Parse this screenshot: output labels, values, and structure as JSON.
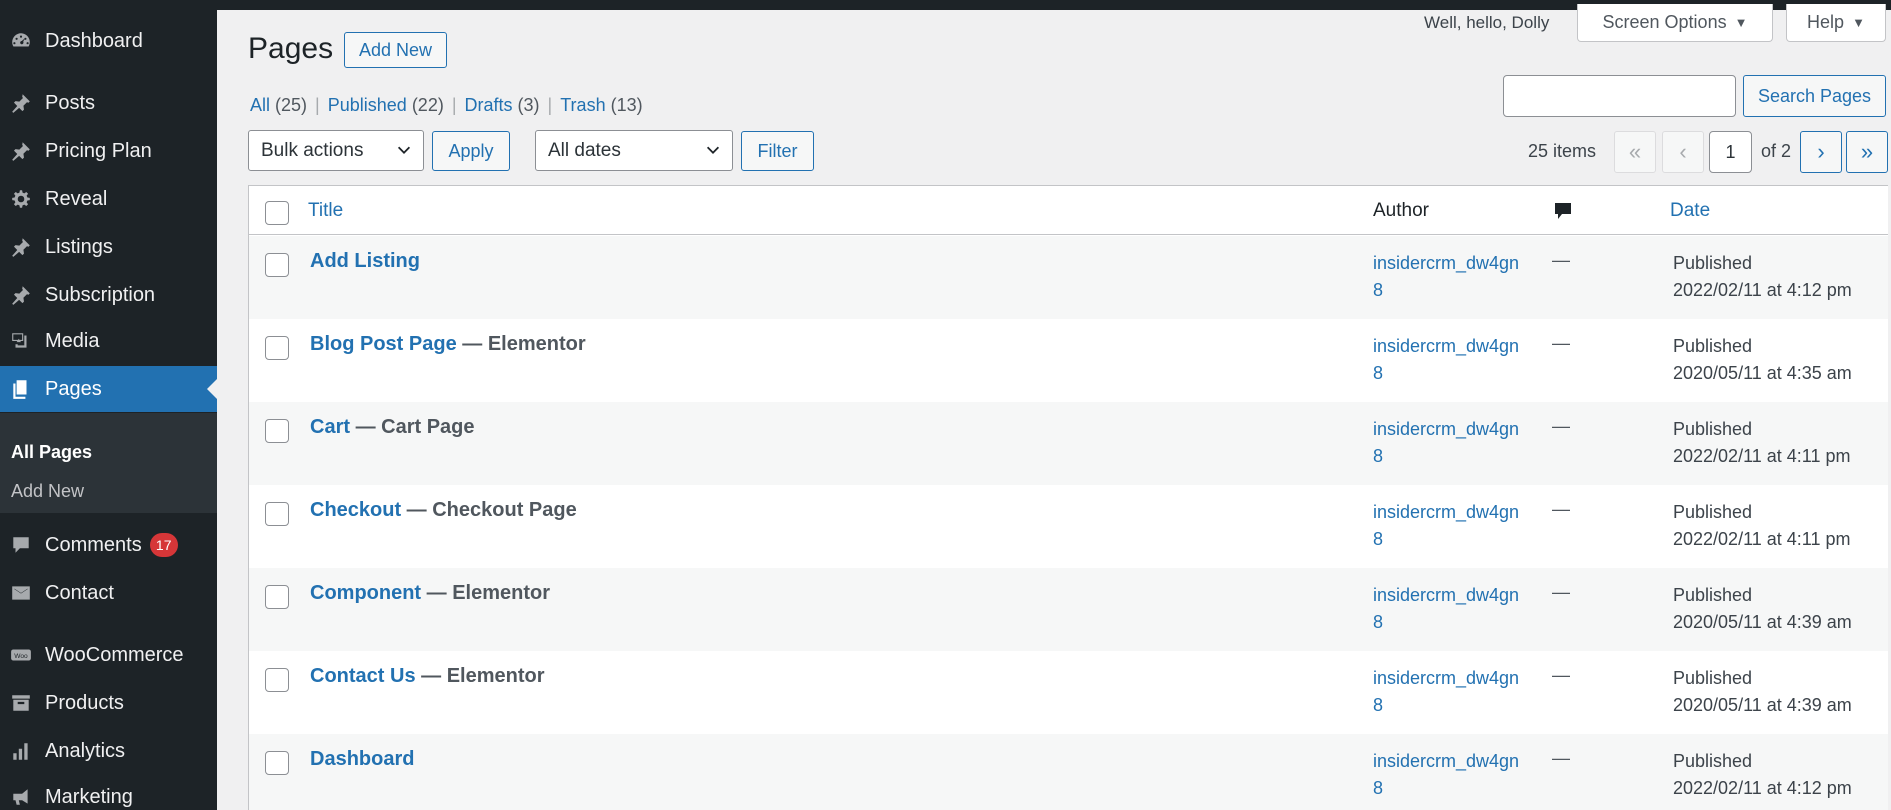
{
  "sidebar": {
    "items": [
      {
        "label": "Dashboard",
        "icon": "dashboard-icon"
      },
      {
        "label": "Posts",
        "icon": "pin-icon"
      },
      {
        "label": "Pricing Plan",
        "icon": "pin-icon"
      },
      {
        "label": "Reveal",
        "icon": "gear-icon"
      },
      {
        "label": "Listings",
        "icon": "pin-icon"
      },
      {
        "label": "Subscription",
        "icon": "pin-icon"
      },
      {
        "label": "Media",
        "icon": "media-icon"
      },
      {
        "label": "Pages",
        "icon": "pages-icon"
      },
      {
        "label": "Comments",
        "icon": "comment-icon",
        "badge": "17"
      },
      {
        "label": "Contact",
        "icon": "mail-icon"
      },
      {
        "label": "WooCommerce",
        "icon": "woo-icon"
      },
      {
        "label": "Products",
        "icon": "archive-icon"
      },
      {
        "label": "Analytics",
        "icon": "bar-chart-icon"
      },
      {
        "label": "Marketing",
        "icon": "megaphone-icon"
      }
    ],
    "submenu": [
      "All Pages",
      "Add New"
    ]
  },
  "header": {
    "greeting": "Well, hello, Dolly",
    "screen_options": "Screen Options",
    "help": "Help",
    "title": "Pages",
    "add_new": "Add New"
  },
  "filters": {
    "views": [
      {
        "label": "All",
        "count": "(25)"
      },
      {
        "label": "Published",
        "count": "(22)"
      },
      {
        "label": "Drafts",
        "count": "(3)"
      },
      {
        "label": "Trash",
        "count": "(13)"
      }
    ],
    "search_button": "Search Pages",
    "search_value": "",
    "bulk_actions": "Bulk actions",
    "apply": "Apply",
    "all_dates": "All dates",
    "filter": "Filter"
  },
  "pagination": {
    "items": "25 items",
    "first": "«",
    "prev": "‹",
    "current": "1",
    "of": "of 2",
    "next": "›",
    "last": "»"
  },
  "table": {
    "columns": {
      "title": "Title",
      "author": "Author",
      "comments_icon": "comment-icon",
      "date": "Date"
    },
    "rows": [
      {
        "title": "Add Listing",
        "state": "",
        "author_line1": "insidercrm_dw4gn",
        "author_line2": "8",
        "comments": "—",
        "status": "Published",
        "date": "2022/02/11 at 4:12 pm"
      },
      {
        "title": "Blog Post Page",
        "state": " — Elementor",
        "author_line1": "insidercrm_dw4gn",
        "author_line2": "8",
        "comments": "—",
        "status": "Published",
        "date": "2020/05/11 at 4:35 am"
      },
      {
        "title": "Cart",
        "state": " — Cart Page",
        "author_line1": "insidercrm_dw4gn",
        "author_line2": "8",
        "comments": "—",
        "status": "Published",
        "date": "2022/02/11 at 4:11 pm"
      },
      {
        "title": "Checkout",
        "state": " — Checkout Page",
        "author_line1": "insidercrm_dw4gn",
        "author_line2": "8",
        "comments": "—",
        "status": "Published",
        "date": "2022/02/11 at 4:11 pm"
      },
      {
        "title": "Component",
        "state": " — Elementor",
        "author_line1": "insidercrm_dw4gn",
        "author_line2": "8",
        "comments": "—",
        "status": "Published",
        "date": "2020/05/11 at 4:39 am"
      },
      {
        "title": "Contact Us",
        "state": " — Elementor",
        "author_line1": "insidercrm_dw4gn",
        "author_line2": "8",
        "comments": "—",
        "status": "Published",
        "date": "2020/05/11 at 4:39 am"
      },
      {
        "title": "Dashboard",
        "state": "",
        "author_line1": "insidercrm_dw4gn",
        "author_line2": "8",
        "comments": "—",
        "status": "Published",
        "date": "2022/02/11 at 4:12 pm"
      }
    ]
  },
  "colors": {
    "sidebar_bg": "#1d2327",
    "accent": "#2271b1",
    "badge": "#d63638"
  }
}
